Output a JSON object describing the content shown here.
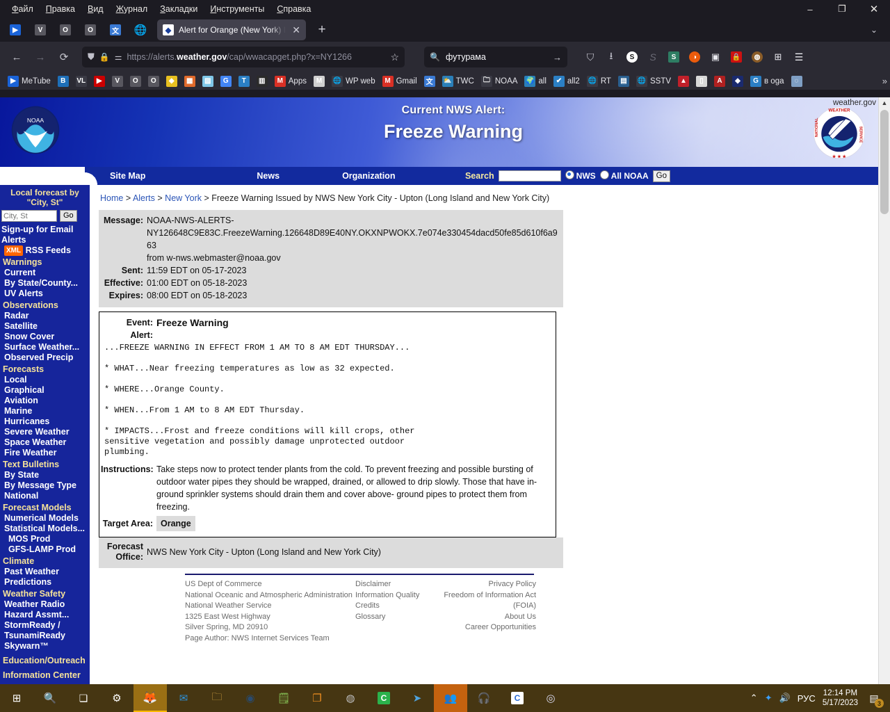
{
  "browser": {
    "menus": [
      "Файл",
      "Правка",
      "Вид",
      "Журнал",
      "Закладки",
      "Инструменты",
      "Справка"
    ],
    "window_controls": {
      "minimize": "–",
      "maximize": "❐",
      "close": "✕"
    },
    "pinned_tabs": [
      "metube-icon",
      "v-icon",
      "o-icon",
      "o2-icon",
      "translate-icon",
      "globe-icon"
    ],
    "tab": {
      "title": "Alert for Orange (New York) Issu",
      "favicon": "noaa-icon",
      "close": "✕"
    },
    "new_tab": "+",
    "list_all_tabs": "⌄",
    "nav": {
      "back": "←",
      "forward": "→",
      "reload": "⟳"
    },
    "url": {
      "scheme": "https://alerts.",
      "domain": "weather.gov",
      "path": "/cap/wwacapget.php?x=NY1266",
      "bookmark_star": "☆"
    },
    "search": {
      "value": "футурама",
      "go": "→",
      "icon": "search-icon"
    },
    "extensions": [
      "pocket-icon",
      "downloads-icon",
      "s-icon",
      "script-icon",
      "evernote-icon",
      "opera-vpn-icon",
      "screenshot-icon",
      "lock-icon",
      "badger-icon",
      "extension-icon",
      "menu-icon"
    ],
    "bookmarks": [
      {
        "label": "MeTube",
        "icon": "metube-icon"
      },
      {
        "label": "",
        "icon": "bitview-icon"
      },
      {
        "label": "",
        "icon": "vl-icon"
      },
      {
        "label": "",
        "icon": "youtube-icon"
      },
      {
        "label": "",
        "icon": "v-icon"
      },
      {
        "label": "",
        "icon": "o-icon"
      },
      {
        "label": "",
        "icon": "o2-icon"
      },
      {
        "label": "",
        "icon": "yellow-icon"
      },
      {
        "label": "",
        "icon": "tinkercad-icon"
      },
      {
        "label": "",
        "icon": "image-icon"
      },
      {
        "label": "",
        "icon": "google-icon"
      },
      {
        "label": "",
        "icon": "telegram-blue-icon"
      },
      {
        "label": "",
        "icon": "bank-icon"
      },
      {
        "label": "Apps",
        "icon": "m-icon"
      },
      {
        "label": "",
        "icon": "ms-icon"
      },
      {
        "label": "WP web",
        "icon": "globe-icon"
      },
      {
        "label": "Gmail",
        "icon": "gmail-icon"
      },
      {
        "label": "",
        "icon": "translate-icon"
      },
      {
        "label": "TWC",
        "icon": "twc-icon"
      },
      {
        "label": "NOAA",
        "icon": "folder-icon"
      },
      {
        "label": "all",
        "icon": "earth-icon"
      },
      {
        "label": "all2",
        "icon": "check-icon"
      },
      {
        "label": "RT",
        "icon": "globe-icon"
      },
      {
        "label": "",
        "icon": "news-icon"
      },
      {
        "label": "SSTV",
        "icon": "globe-icon"
      },
      {
        "label": "",
        "icon": "red-dragon-icon"
      },
      {
        "label": "",
        "icon": "phone-icon"
      },
      {
        "label": "",
        "icon": "a-icon"
      },
      {
        "label": "",
        "icon": "diamond-icon"
      },
      {
        "label": "в oga",
        "icon": "g-icon"
      },
      {
        "label": "",
        "icon": "q-icon"
      }
    ],
    "bookmarks_overflow": "»"
  },
  "page": {
    "weather_gov": "weather.gov",
    "header": {
      "line1": "Current NWS Alert:",
      "line2": "Freeze Warning",
      "noaa_logo": "noaa-logo",
      "nws_logo": "nws-logo"
    },
    "navbar": {
      "links": [
        "Site Map",
        "News",
        "Organization"
      ],
      "search_label": "Search",
      "search_value": "",
      "radio_nws": "NWS",
      "radio_all_noaa": "All NOAA",
      "go": "Go",
      "selected_scope": "NWS"
    },
    "sidebar": {
      "heading_line1": "Local forecast by",
      "heading_line2": "\"City, St\"",
      "city_placeholder": "City, St",
      "city_value": "",
      "go": "Go",
      "email_alerts_line1": "Sign-up for Email",
      "email_alerts_line2": "Alerts",
      "xml_badge": "XML",
      "rss_label": "RSS Feeds",
      "sections": [
        {
          "title": "Warnings",
          "items": [
            "Current",
            "By State/County...",
            "UV Alerts"
          ]
        },
        {
          "title": "Observations",
          "items": [
            "Radar",
            "Satellite",
            "Snow Cover",
            "Surface Weather...",
            "Observed Precip"
          ]
        },
        {
          "title": "Forecasts",
          "items": [
            "Local",
            "Graphical",
            "Aviation",
            "Marine",
            "Hurricanes",
            "Severe Weather",
            "Space Weather",
            "Fire Weather"
          ]
        },
        {
          "title": "Text Bulletins",
          "items": [
            "By State",
            "By Message Type",
            "National"
          ]
        },
        {
          "title": "Forecast Models",
          "items": [
            "Numerical Models",
            "Statistical Models...",
            "MOS Prod",
            "GFS-LAMP Prod"
          ]
        },
        {
          "title": "Climate",
          "items": [
            "Past Weather",
            "Predictions"
          ]
        },
        {
          "title": "Weather Safety",
          "items": [
            "Weather Radio",
            "Hazard Assmt...",
            "StormReady /",
            "TsunamiReady",
            "Skywarn™"
          ]
        }
      ],
      "bottom_links": [
        "Education/Outreach",
        "Information Center"
      ]
    },
    "breadcrumb": {
      "items": [
        "Home",
        "Alerts",
        "New York"
      ],
      "separator": ">",
      "current": "Freeze Warning Issued by NWS New York City - Upton (Long Island and New York City)"
    },
    "message": {
      "message_label": "Message:",
      "message_line1": "NOAA-NWS-ALERTS-",
      "message_line2": "NY126648C9E83C.FreezeWarning.126648D89E40NY.OKXNPWOKX.7e074e330454dacd50fe85d610f6a963",
      "message_line3": "from w-nws.webmaster@noaa.gov",
      "sent_label": "Sent:",
      "sent_value": "11:59 EDT on 05-17-2023",
      "effective_label": "Effective:",
      "effective_value": "01:00 EDT on 05-18-2023",
      "expires_label": "Expires:",
      "expires_value": "08:00 EDT on 05-18-2023"
    },
    "alert": {
      "event_label": "Event:",
      "event_value": "Freeze Warning",
      "alert_label": "Alert:",
      "alert_text": "...FREEZE WARNING IN EFFECT FROM 1 AM TO 8 AM EDT THURSDAY...\n\n* WHAT...Near freezing temperatures as low as 32 expected.\n\n* WHERE...Orange County.\n\n* WHEN...From 1 AM to 8 AM EDT Thursday.\n\n* IMPACTS...Frost and freeze conditions will kill crops, other\nsensitive vegetation and possibly damage unprotected outdoor\nplumbing.",
      "instructions_label": "Instructions:",
      "instructions_value": "Take steps now to protect tender plants from the cold. To prevent freezing and possible bursting of outdoor water pipes they should be wrapped, drained, or allowed to drip slowly. Those that have in-ground sprinkler systems should drain them and cover above- ground pipes to protect them from freezing.",
      "target_area_label": "Target Area:",
      "target_area_value": "Orange"
    },
    "forecast_office": {
      "label_line1": "Forecast",
      "label_line2": "Office:",
      "value": "NWS New York City - Upton (Long Island and New York City)"
    },
    "footer": {
      "col1": [
        "US Dept of Commerce",
        "National Oceanic and Atmospheric Administration",
        "National Weather Service",
        "1325 East West Highway",
        "Silver Spring, MD 20910",
        "Page Author: NWS Internet Services Team"
      ],
      "col2": [
        "Disclaimer",
        "Information Quality",
        "Credits",
        "Glossary"
      ],
      "col3": [
        "Privacy Policy",
        "Freedom of Information Act (FOIA)",
        "About Us",
        "Career Opportunities"
      ]
    }
  },
  "taskbar": {
    "start": "start-icon",
    "items": [
      "search-icon",
      "task-view-icon",
      "settings-icon",
      "firefox-icon",
      "thunderbird-icon",
      "explorer-icon",
      "steam-icon",
      "notepad-icon",
      "vmware-icon",
      "obs-icon",
      "c-icon",
      "telegram-icon",
      "users-icon",
      "headphones-icon",
      "c2-icon",
      "nws-icon"
    ],
    "tray": {
      "chevron": "⌃",
      "bluetooth": "bluetooth-icon",
      "volume": "volume-icon",
      "language": "РУС",
      "time": "12:14 PM",
      "date": "5/17/2023",
      "notification_count": "3"
    }
  },
  "colors": {
    "nws_blue": "#16259b",
    "nav_blue": "#122a9e",
    "sidebar_heading": "#f5e29a",
    "link_blue": "#2b55b7",
    "taskbar": "#463612"
  }
}
